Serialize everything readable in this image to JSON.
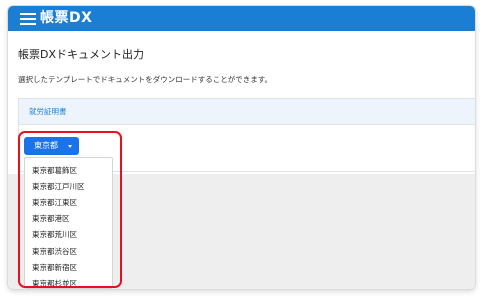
{
  "app": {
    "logo_text": "帳票DX"
  },
  "page": {
    "title": "帳票DXドキュメント出力",
    "description": "選択したテンプレートでドキュメントをダウンロードすることができます。"
  },
  "card": {
    "header_label": "就労証明書"
  },
  "dropdown": {
    "selected": "東京都",
    "options": [
      "東京都葛飾区",
      "東京都江戸川区",
      "東京都江東区",
      "東京都港区",
      "東京都荒川区",
      "東京都渋谷区",
      "東京都新宿区",
      "東京都杉並区"
    ]
  },
  "colors": {
    "header_bg": "#1a7fd4",
    "primary_button": "#1a73e8",
    "card_header_bg": "#eef4fb",
    "highlight_border": "#e8101e"
  },
  "icons": {
    "menu": "hamburger-icon",
    "dropdown": "caret-down-icon"
  }
}
